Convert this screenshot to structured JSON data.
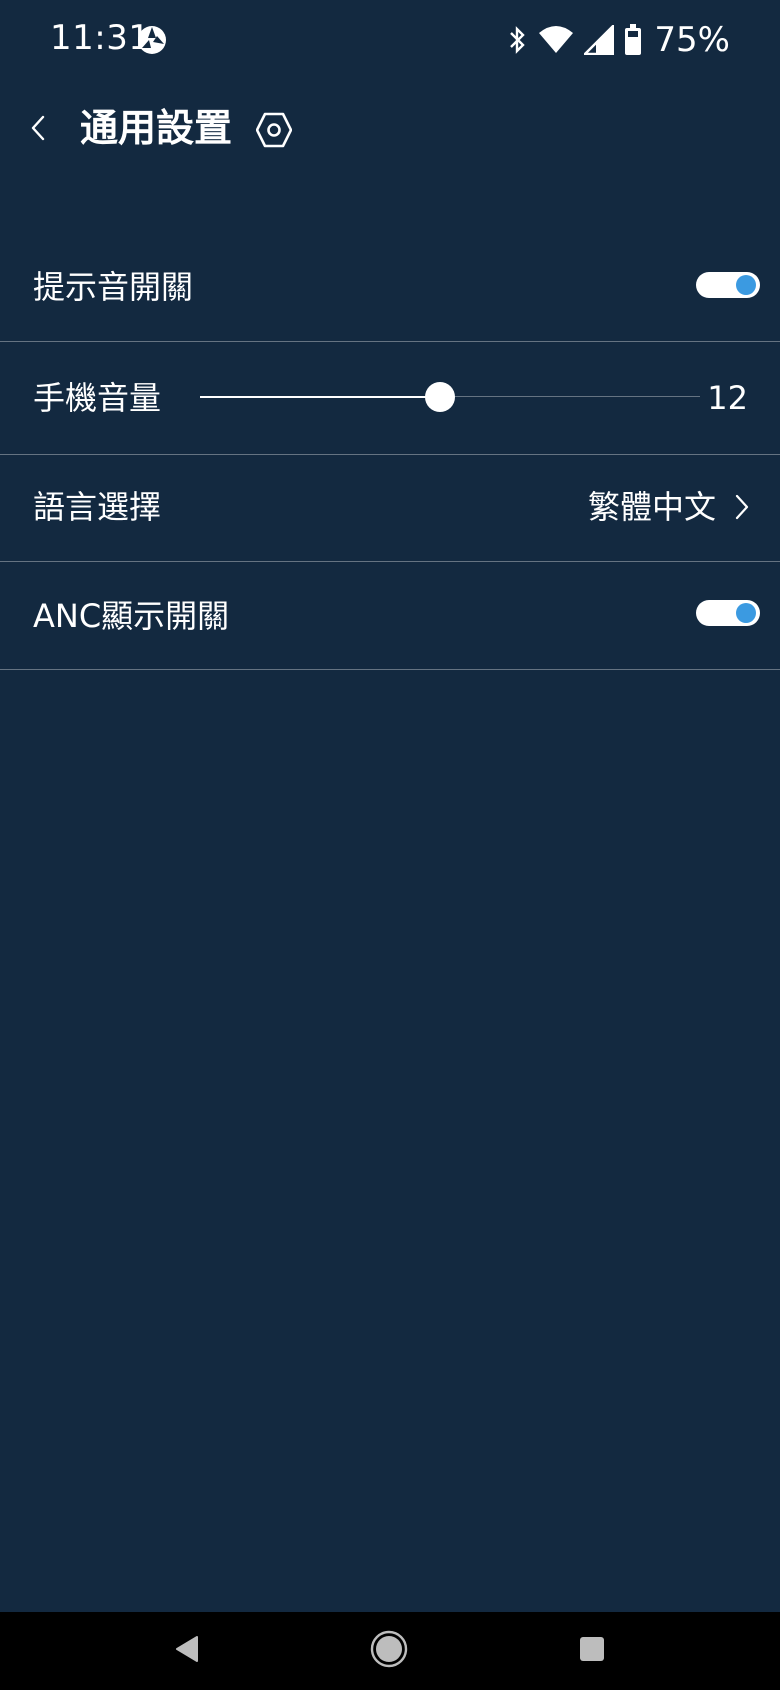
{
  "status_bar": {
    "time": "11:31",
    "app_icon": "aperture-icon",
    "icons": [
      "bluetooth-icon",
      "wifi-icon",
      "cell-signal-icon",
      "battery-icon"
    ],
    "battery_percent": "75%"
  },
  "header": {
    "back_icon": "chevron-left-icon",
    "title": "通用設置",
    "title_icon": "hex-settings-icon"
  },
  "settings": {
    "prompt_tone": {
      "label": "提示音開關",
      "enabled": true
    },
    "phone_volume": {
      "label": "手機音量",
      "value": "12",
      "level_fraction": 0.48
    },
    "language": {
      "label": "語言選擇",
      "value": "繁體中文",
      "icon": "chevron-right-icon"
    },
    "anc_display": {
      "label": "ANC顯示開關",
      "enabled": true
    }
  },
  "nav_bar": {
    "icons": [
      "back-triangle-icon",
      "home-circle-icon",
      "recents-square-icon"
    ]
  },
  "colors": {
    "background": "#132940",
    "accent": "#3b9ae1",
    "divider": "rgba(255,255,255,0.35)",
    "nav_bar": "#000000"
  }
}
